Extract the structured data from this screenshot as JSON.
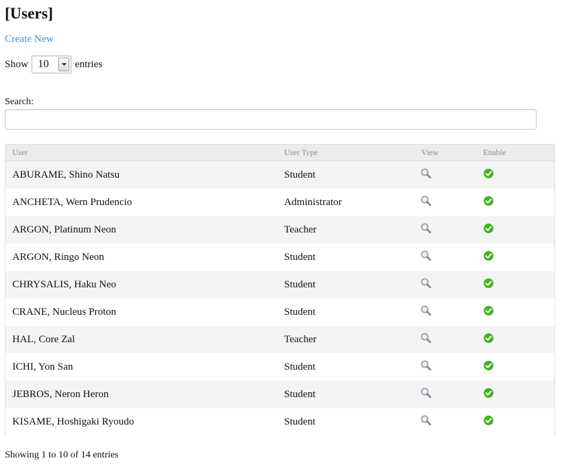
{
  "page": {
    "title": "[Users]",
    "create_link": "Create New"
  },
  "length_control": {
    "show_label": "Show",
    "selected": "10",
    "entries_label": "entries"
  },
  "search": {
    "label": "Search:",
    "value": ""
  },
  "table": {
    "columns": [
      "User",
      "User Type",
      "View",
      "Enable"
    ],
    "rows": [
      {
        "user": "ABURAME, Shino Natsu",
        "type": "Student",
        "enabled": true
      },
      {
        "user": "ANCHETA, Wern Prudencio",
        "type": "Administrator",
        "enabled": true
      },
      {
        "user": "ARGON, Platinum Neon",
        "type": "Teacher",
        "enabled": true
      },
      {
        "user": "ARGON, Ringo Neon",
        "type": "Student",
        "enabled": true
      },
      {
        "user": "CHRYSALIS, Haku Neo",
        "type": "Student",
        "enabled": true
      },
      {
        "user": "CRANE, Nucleus Proton",
        "type": "Student",
        "enabled": true
      },
      {
        "user": "HAL, Core Zal",
        "type": "Teacher",
        "enabled": true
      },
      {
        "user": "ICHI, Yon San",
        "type": "Student",
        "enabled": true
      },
      {
        "user": "JEBROS, Neron Heron",
        "type": "Student",
        "enabled": true
      },
      {
        "user": "KISAME, Hoshigaki Ryoudo",
        "type": "Student",
        "enabled": true
      }
    ]
  },
  "footer": {
    "info": "Showing 1 to 10 of 14 entries"
  },
  "colors": {
    "link": "#4a8fc7",
    "enabled_check": "#3cb521",
    "header_bg": "#ececec",
    "stripe_bg": "#f4f4f4"
  },
  "icons": {
    "view": "magnifier-icon",
    "enable": "green-check-circle-icon",
    "select": "chevron-down-icon"
  }
}
